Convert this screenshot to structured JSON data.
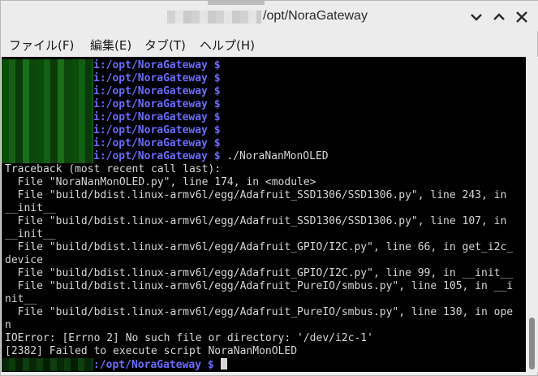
{
  "window": {
    "title": "/opt/NoraGateway"
  },
  "menu": {
    "items": [
      "ファイル(F)",
      "編集(E)",
      "タブ(T)",
      "ヘルプ(H)"
    ]
  },
  "terminal": {
    "prompt_suffix": "i:",
    "prompt_path": "/opt/NoraGateway $",
    "command": " ./NoraNanMonOLED",
    "output": [
      "Traceback (most recent call last):",
      "  File \"NoraNanMonOLED.py\", line 174, in <module>",
      "  File \"build/bdist.linux-armv6l/egg/Adafruit_SSD1306/SSD1306.py\", line 243, in",
      "__init__",
      "  File \"build/bdist.linux-armv6l/egg/Adafruit_SSD1306/SSD1306.py\", line 107, in",
      "__init__",
      "  File \"build/bdist.linux-armv6l/egg/Adafruit_GPIO/I2C.py\", line 66, in get_i2c_",
      "device",
      "  File \"build/bdist.linux-armv6l/egg/Adafruit_GPIO/I2C.py\", line 99, in __init__",
      "  File \"build/bdist.linux-armv6l/egg/Adafruit_PureIO/smbus.py\", line 105, in __i",
      "nit__",
      "  File \"build/bdist.linux-armv6l/egg/Adafruit_PureIO/smbus.py\", line 130, in ope",
      "n",
      "IOError: [Errno 2] No such file or directory: '/dev/i2c-1'",
      "[2382] Failed to execute script NoraNanMonOLED"
    ],
    "final_prompt_path": ":/opt/NoraGateway $"
  },
  "icons": {
    "minimize": "chevron-down-icon",
    "maximize": "chevron-up-icon",
    "close": "close-icon"
  },
  "colors": {
    "prompt": "#6b6bff",
    "terminal_bg": "#000000",
    "terminal_fg": "#d6d6d6"
  }
}
